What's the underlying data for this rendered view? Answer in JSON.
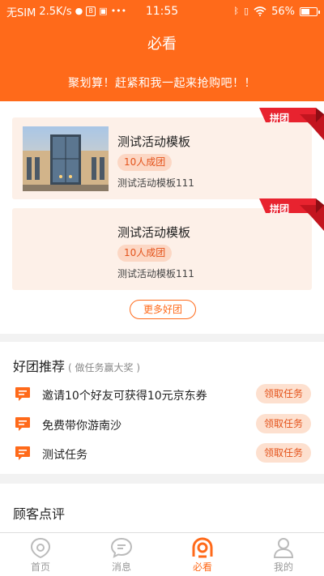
{
  "status_bar": {
    "carrier": "无SIM",
    "speed": "2.5K/s",
    "time": "11:55",
    "battery": "56%"
  },
  "header": {
    "title": "必看",
    "banner": "聚划算！赶紧和我一起来抢购吧！！"
  },
  "groups": {
    "ribbon_label": "拼团",
    "items": [
      {
        "title": "测试活动模板",
        "badge": "10人成团",
        "subtitle": "测试活动模板111",
        "has_image": true
      },
      {
        "title": "测试活动模板",
        "badge": "10人成团",
        "subtitle": "测试活动模板111",
        "has_image": false
      }
    ],
    "more_label": "更多好团"
  },
  "tasks": {
    "title": "好团推荐",
    "subtitle": "( 做任务赢大奖 )",
    "items": [
      {
        "text": "邀请10个好友可获得10元京东券",
        "button": "领取任务"
      },
      {
        "text": "免费带你游南沙",
        "button": "领取任务"
      },
      {
        "text": "测试任务",
        "button": "领取任务"
      }
    ]
  },
  "reviews": {
    "title": "顾客点评"
  },
  "tabbar": {
    "items": [
      {
        "label": "首页",
        "icon": "home-icon",
        "active": false
      },
      {
        "label": "消息",
        "icon": "message-icon",
        "active": false
      },
      {
        "label": "必看",
        "icon": "must-see-icon",
        "active": true
      },
      {
        "label": "我的",
        "icon": "profile-icon",
        "active": false
      }
    ]
  },
  "colors": {
    "accent": "#ff6a1a",
    "ribbon": "#e8232f",
    "card_bg": "#fdf0e8"
  }
}
